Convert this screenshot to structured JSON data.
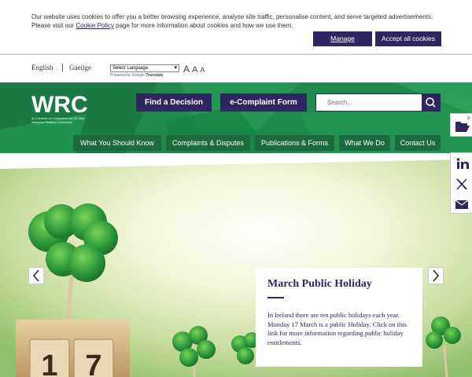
{
  "cookie": {
    "text_before": "Our website uses cookies to offer you a better browsing experience, analyse site traffic, personalise content, and serve targeted advertisements. Please visit our ",
    "policy_link": "Cookie Policy",
    "text_after": " page for more information about cookies and how we use them.",
    "manage_label": "Manage cookies",
    "accept_label": "Accept all cookies"
  },
  "langbar": {
    "english": "English",
    "irish": "Gaeilge",
    "translate_select": "Select Language",
    "powered_by": "Powered by",
    "google": "Google",
    "translate": "Translate",
    "font_sizes": [
      "A",
      "A",
      "A"
    ]
  },
  "header": {
    "logo": "WRC",
    "logo_sub_ga": "An Coimisiún um Chaidreamh san Áit Oibre",
    "logo_sub_en": "Workplace Relations Commission",
    "find_decision": "Find a Decision",
    "ecomplaint": "e-Complaint Form",
    "search_placeholder": "Search...",
    "nav": [
      "What You Should Know",
      "Complaints & Disputes",
      "Publications & Forms",
      "What We Do",
      "Contact Us"
    ]
  },
  "hero": {
    "title": "March Public Holiday",
    "body": "In Ireland there are ten public holidays each year. Monday 17 March is a public Holiday. Click on this link for more information regarding public holiday entitlements.",
    "calendar_digits": [
      "1",
      "7"
    ]
  },
  "side": {
    "folder_count": "0"
  },
  "colors": {
    "brand_green": "#1f8a4c",
    "nav_green": "#1b6b3c",
    "brand_purple": "#2d2660"
  }
}
